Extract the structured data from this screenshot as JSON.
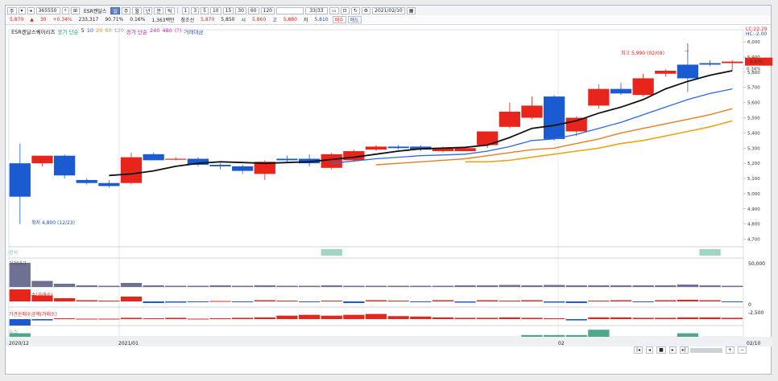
{
  "toolbar": {
    "code": "365550",
    "name": "ESR켄달스",
    "periods": [
      "일",
      "주",
      "월",
      "년",
      "분",
      "틱"
    ],
    "minutes": [
      "1",
      "3",
      "5",
      "10",
      "15",
      "30",
      "60",
      "120"
    ],
    "count_value": "33/33",
    "date": "2021/02/10",
    "price": "5,870",
    "change": "30",
    "change_pct": "+0.34%",
    "volume": "233,317",
    "vol_pct": "90.71%",
    "turnover": "0.16%",
    "amount": "1,363백만",
    "indicator_label": "참조선",
    "ref_price": "5,870",
    "prev_close": "5,850",
    "open_label": "시",
    "open": "5,860",
    "high_label": "고",
    "high": "5,880",
    "low_label": "저",
    "low": "5,810",
    "buy_label": "매수",
    "sell_label": "매도"
  },
  "legend": {
    "name": "ESR켄달스퀘어리츠",
    "ma_label": "종가 단순",
    "ma_periods": [
      "5",
      "10",
      "20",
      "60",
      "120"
    ],
    "ma2_label": "종가 단순",
    "ma2_periods": [
      "240",
      "480",
      "(?)"
    ],
    "volume_label": "거래대금"
  },
  "colors": {
    "up": "#e8251b",
    "down": "#1a5bd1",
    "ma5": "#111111",
    "ma10": "#2b6ae0",
    "ma20": "#ef7b1e",
    "ma60": "#eaa51a",
    "panel_green": "#9fd6c1"
  },
  "annotations": {
    "high": "최고 5,990 (02/08)",
    "low": "최저 4,800 (12/23)",
    "top_right_1": "LC:22.29",
    "top_right_2": "HC:-2.00",
    "current_price": "5,870",
    "current_pct": "0.34%"
  },
  "panels": [
    {
      "label": "공시"
    },
    {
      "label": "거래대금",
      "axis": "50,000"
    },
    {
      "label": "외국인순매수(거래소)",
      "axis": "0"
    },
    {
      "label": "기관순매수금액(거래소)",
      "axis": "-2,500"
    },
    {
      "label": "뉴스"
    }
  ],
  "x_labels": [
    "2020/12",
    "2021/01",
    "02",
    "02/10"
  ],
  "chart_data": {
    "type": "candlestick",
    "ylim": [
      4650,
      6080
    ],
    "y_ticks": [
      "6,000",
      "5,900",
      "5,800",
      "5,700",
      "5,600",
      "5,500",
      "5,400",
      "5,300",
      "5,200",
      "5,100",
      "5,000",
      "4,900",
      "4,800",
      "4,700"
    ],
    "candles": [
      {
        "o": 5200,
        "h": 5330,
        "l": 4800,
        "c": 4980
      },
      {
        "o": 5200,
        "h": 5230,
        "l": 5180,
        "c": 5250
      },
      {
        "o": 5250,
        "h": 5260,
        "l": 5100,
        "c": 5120
      },
      {
        "o": 5090,
        "h": 5100,
        "l": 5060,
        "c": 5070
      },
      {
        "o": 5070,
        "h": 5090,
        "l": 5040,
        "c": 5050
      },
      {
        "o": 5070,
        "h": 5270,
        "l": 5060,
        "c": 5240
      },
      {
        "o": 5260,
        "h": 5270,
        "l": 5220,
        "c": 5220
      },
      {
        "o": 5230,
        "h": 5240,
        "l": 5220,
        "c": 5230
      },
      {
        "o": 5230,
        "h": 5240,
        "l": 5180,
        "c": 5190
      },
      {
        "o": 5190,
        "h": 5200,
        "l": 5160,
        "c": 5180
      },
      {
        "o": 5180,
        "h": 5190,
        "l": 5130,
        "c": 5150
      },
      {
        "o": 5130,
        "h": 5220,
        "l": 5090,
        "c": 5210
      },
      {
        "o": 5230,
        "h": 5250,
        "l": 5200,
        "c": 5220
      },
      {
        "o": 5230,
        "h": 5260,
        "l": 5180,
        "c": 5200
      },
      {
        "o": 5170,
        "h": 5270,
        "l": 5160,
        "c": 5260
      },
      {
        "o": 5220,
        "h": 5290,
        "l": 5210,
        "c": 5280
      },
      {
        "o": 5290,
        "h": 5320,
        "l": 5280,
        "c": 5310
      },
      {
        "o": 5310,
        "h": 5320,
        "l": 5290,
        "c": 5300
      },
      {
        "o": 5310,
        "h": 5320,
        "l": 5280,
        "c": 5290
      },
      {
        "o": 5280,
        "h": 5310,
        "l": 5270,
        "c": 5300
      },
      {
        "o": 5280,
        "h": 5310,
        "l": 5280,
        "c": 5300
      },
      {
        "o": 5320,
        "h": 5410,
        "l": 5300,
        "c": 5410
      },
      {
        "o": 5440,
        "h": 5600,
        "l": 5430,
        "c": 5540
      },
      {
        "o": 5500,
        "h": 5640,
        "l": 5490,
        "c": 5580
      },
      {
        "o": 5640,
        "h": 5650,
        "l": 5350,
        "c": 5360
      },
      {
        "o": 5410,
        "h": 5510,
        "l": 5380,
        "c": 5500
      },
      {
        "o": 5580,
        "h": 5720,
        "l": 5560,
        "c": 5690
      },
      {
        "o": 5690,
        "h": 5730,
        "l": 5650,
        "c": 5660
      },
      {
        "o": 5650,
        "h": 5790,
        "l": 5640,
        "c": 5760
      },
      {
        "o": 5790,
        "h": 5820,
        "l": 5770,
        "c": 5810
      },
      {
        "o": 5850,
        "h": 5990,
        "l": 5670,
        "c": 5760
      },
      {
        "o": 5860,
        "h": 5880,
        "l": 5840,
        "c": 5850
      },
      {
        "o": 5860,
        "h": 5880,
        "l": 5810,
        "c": 5870
      }
    ],
    "ma5": [
      null,
      null,
      null,
      null,
      5120,
      5130,
      5150,
      5180,
      5200,
      5210,
      5205,
      5200,
      5205,
      5210,
      5225,
      5240,
      5260,
      5280,
      5295,
      5300,
      5305,
      5320,
      5370,
      5430,
      5450,
      5480,
      5530,
      5570,
      5620,
      5690,
      5740,
      5780,
      5810
    ],
    "ma10": [
      null,
      null,
      null,
      null,
      null,
      null,
      null,
      null,
      null,
      null,
      null,
      null,
      null,
      null,
      5200,
      5215,
      5230,
      5240,
      5250,
      5255,
      5260,
      5280,
      5310,
      5350,
      5360,
      5390,
      5430,
      5470,
      5520,
      5570,
      5620,
      5660,
      5690
    ],
    "ma20": [
      null,
      null,
      null,
      null,
      null,
      null,
      null,
      null,
      null,
      null,
      null,
      null,
      null,
      null,
      null,
      null,
      5190,
      5200,
      5210,
      5220,
      5230,
      5250,
      5270,
      5290,
      5300,
      5330,
      5360,
      5400,
      5430,
      5460,
      5490,
      5520,
      5560
    ],
    "ma60": [
      null,
      null,
      null,
      null,
      null,
      null,
      null,
      null,
      null,
      null,
      null,
      null,
      null,
      null,
      null,
      null,
      null,
      null,
      null,
      null,
      5210,
      5210,
      5220,
      5240,
      5260,
      5280,
      5300,
      5330,
      5350,
      5380,
      5410,
      5440,
      5480
    ],
    "disclosure": [
      0,
      0,
      0,
      0,
      0,
      0,
      0,
      0,
      0,
      0,
      0,
      0,
      0,
      0,
      1,
      0,
      0,
      0,
      0,
      0,
      0,
      0,
      0,
      0,
      0,
      0,
      0,
      0,
      0,
      0,
      0,
      1,
      0
    ],
    "trade_value": [
      60,
      15,
      8,
      4,
      3,
      10,
      4,
      3,
      3,
      4,
      3,
      4,
      3,
      3,
      4,
      3,
      3,
      3,
      3,
      3,
      4,
      4,
      5,
      4,
      5,
      4,
      4,
      4,
      4,
      4,
      6,
      4,
      3
    ],
    "foreign_net": [
      30,
      15,
      8,
      3,
      2,
      12,
      -4,
      -3,
      -2,
      1,
      -2,
      3,
      2,
      -2,
      2,
      -4,
      3,
      2,
      -2,
      3,
      -3,
      3,
      2,
      3,
      -3,
      -4,
      2,
      3,
      -2,
      3,
      4,
      3,
      -2
    ],
    "inst_net": [
      -15,
      -3,
      2,
      1,
      1,
      3,
      2,
      3,
      1,
      2,
      3,
      4,
      8,
      10,
      8,
      10,
      12,
      7,
      6,
      4,
      3,
      3,
      4,
      3,
      2,
      -3,
      4,
      4,
      3,
      3,
      4,
      4,
      3
    ],
    "news": [
      2,
      0,
      0,
      0,
      0,
      0,
      0,
      0,
      0,
      0,
      0,
      0,
      0,
      0,
      0,
      0,
      0,
      0,
      0,
      0,
      0,
      0,
      0,
      1,
      1,
      1,
      4,
      0,
      0,
      0,
      2,
      0,
      0
    ]
  }
}
